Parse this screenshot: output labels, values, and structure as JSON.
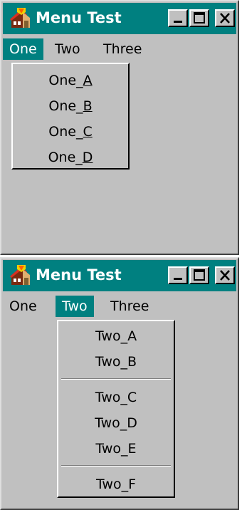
{
  "window1": {
    "title": "Menu Test",
    "menubar": [
      {
        "label": "One",
        "active": true
      },
      {
        "label": "Two",
        "active": false
      },
      {
        "label": "Three",
        "active": false
      }
    ],
    "dropdown": {
      "items": [
        {
          "prefix": "One_",
          "mnemonic": "A"
        },
        {
          "prefix": "One_",
          "mnemonic": "B"
        },
        {
          "prefix": "One_",
          "mnemonic": "C"
        },
        {
          "prefix": "One_",
          "mnemonic": "D"
        }
      ]
    }
  },
  "window2": {
    "title": "Menu Test",
    "menubar": [
      {
        "label": "One",
        "active": false
      },
      {
        "label": "Two",
        "active": true
      },
      {
        "label": "Three",
        "active": false
      }
    ],
    "dropdown": {
      "items": [
        {
          "label": "Two_A"
        },
        {
          "label": "Two_B"
        },
        {
          "label": "Two_C"
        },
        {
          "label": "Two_D"
        },
        {
          "label": "Two_E"
        },
        {
          "label": "Two_F"
        }
      ]
    }
  },
  "colors": {
    "titlebar": "#008080",
    "window_face": "#c0c0c0",
    "menu_highlight": "#008080",
    "title_text": "#ffffff"
  },
  "icons": {
    "app": "house-icon",
    "minimize": "minimize-icon",
    "maximize": "maximize-icon",
    "close": "close-icon"
  }
}
